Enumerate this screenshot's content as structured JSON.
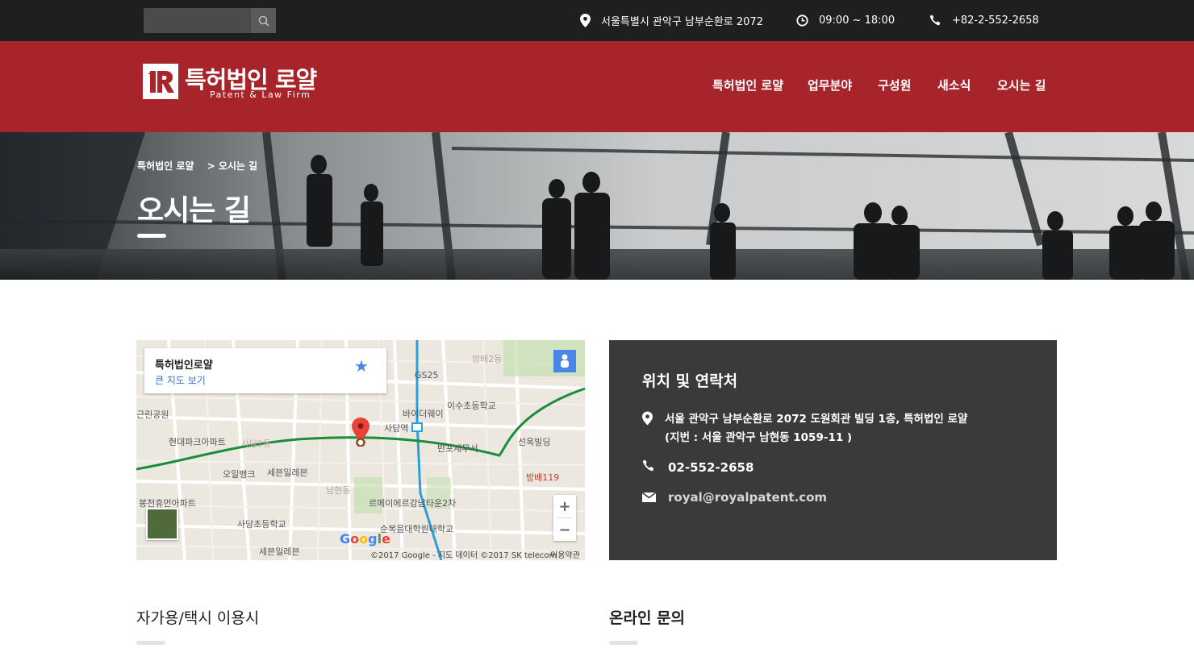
{
  "topbar": {
    "search_placeholder": "",
    "address": "서울특별시 관악구 남부순환로 2072",
    "hours": "09:00 ~ 18:00",
    "phone": "+82-2-552-2658"
  },
  "header": {
    "logo_name": "특허법인 로얄",
    "logo_sub": "Patent & Law Firm",
    "nav": [
      "특허법인 로얄",
      "업무분야",
      "구성원",
      "새소식",
      "오시는 길"
    ]
  },
  "hero": {
    "breadcrumb_home": "특허법인 로얄",
    "breadcrumb_current": "> 오시는 길",
    "title": "오시는 길"
  },
  "map": {
    "place_name": "특허법인로얄",
    "view_larger": "큰 지도 보기",
    "labels": [
      {
        "t": "이수초등학교"
      },
      {
        "t": "바이더웨이"
      },
      {
        "t": "사당역"
      },
      {
        "t": "GS25"
      },
      {
        "t": "현대파크아파트"
      },
      {
        "t": "사당1동"
      },
      {
        "t": "오일뱅크"
      },
      {
        "t": "세븐일레븐"
      },
      {
        "t": "반포세무서"
      },
      {
        "t": "선옥빌딩"
      },
      {
        "t": "방배119"
      },
      {
        "t": "남현동"
      },
      {
        "t": "르메이에르강남타운2차"
      },
      {
        "t": "사당초등학교"
      },
      {
        "t": "순복음대학원대학교"
      },
      {
        "t": "봉천휴먼아파트"
      },
      {
        "t": "근린공원"
      },
      {
        "t": "방배2동"
      },
      {
        "t": "세븐일레븐"
      }
    ],
    "google": "Google",
    "footer": "©2017 Google - 지도 데이터 ©2017 SK telecom",
    "terms": "이용약관",
    "zoom_in": "+",
    "zoom_out": "−",
    "route_color": "#1a8f3a",
    "subway_color": "#2a9fd8"
  },
  "info": {
    "title": "위치 및 연락처",
    "address_line1": "서울 관악구 남부순환로 2072 도원회관 빌딩 1층, 특허법인 로얄",
    "address_line2": "(지번 : 서울 관악구 남현동 1059-11 )",
    "phone": "02-552-2658",
    "email": "royal@royalpatent.com"
  },
  "sections": {
    "left_title": "자가용/택시 이용시",
    "right_title": "온라인 문의"
  },
  "colors": {
    "brand_red": "#a7242b",
    "topbar": "#1f1f1f",
    "info_bg": "#3a3a3a"
  }
}
